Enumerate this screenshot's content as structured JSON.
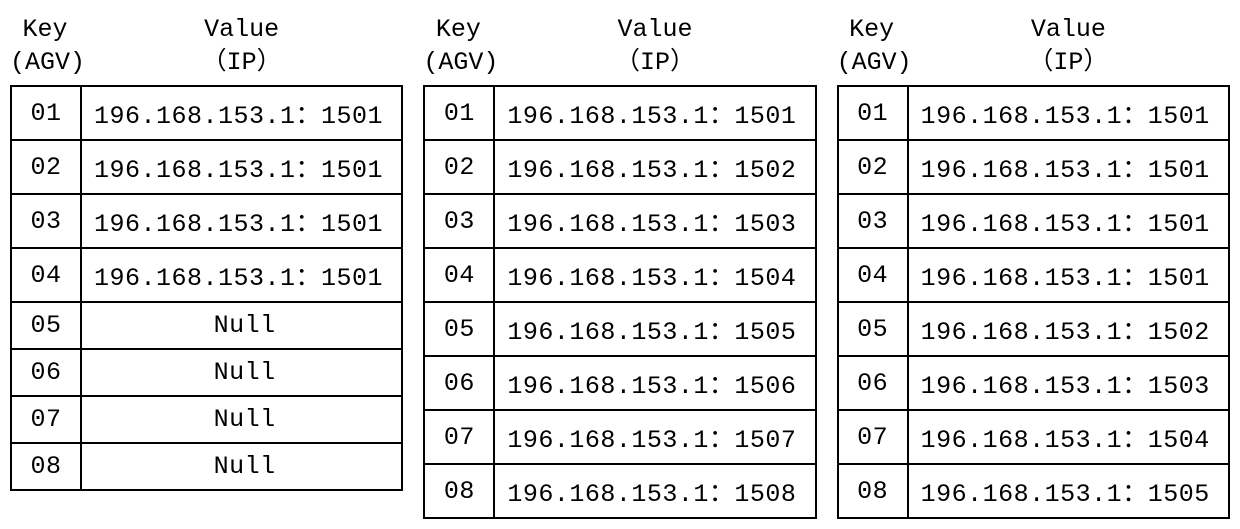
{
  "headers": {
    "key_line1": "Key",
    "key_line2": "(AGV)",
    "value_line1": "Value",
    "value_line2": "（IP）"
  },
  "tables": [
    {
      "rows": [
        {
          "key": "01",
          "value": "196.168.153.1：1501",
          "is_null": false
        },
        {
          "key": "02",
          "value": "196.168.153.1：1501",
          "is_null": false
        },
        {
          "key": "03",
          "value": "196.168.153.1：1501",
          "is_null": false
        },
        {
          "key": "04",
          "value": "196.168.153.1：1501",
          "is_null": false
        },
        {
          "key": "05",
          "value": "Null",
          "is_null": true
        },
        {
          "key": "06",
          "value": "Null",
          "is_null": true
        },
        {
          "key": "07",
          "value": "Null",
          "is_null": true
        },
        {
          "key": "08",
          "value": "Null",
          "is_null": true
        }
      ]
    },
    {
      "rows": [
        {
          "key": "01",
          "value": "196.168.153.1：1501",
          "is_null": false
        },
        {
          "key": "02",
          "value": "196.168.153.1：1502",
          "is_null": false
        },
        {
          "key": "03",
          "value": "196.168.153.1：1503",
          "is_null": false
        },
        {
          "key": "04",
          "value": "196.168.153.1：1504",
          "is_null": false
        },
        {
          "key": "05",
          "value": "196.168.153.1：1505",
          "is_null": false
        },
        {
          "key": "06",
          "value": "196.168.153.1：1506",
          "is_null": false
        },
        {
          "key": "07",
          "value": "196.168.153.1：1507",
          "is_null": false
        },
        {
          "key": "08",
          "value": "196.168.153.1：1508",
          "is_null": false
        }
      ]
    },
    {
      "rows": [
        {
          "key": "01",
          "value": "196.168.153.1：1501",
          "is_null": false
        },
        {
          "key": "02",
          "value": "196.168.153.1：1501",
          "is_null": false
        },
        {
          "key": "03",
          "value": "196.168.153.1：1501",
          "is_null": false
        },
        {
          "key": "04",
          "value": "196.168.153.1：1501",
          "is_null": false
        },
        {
          "key": "05",
          "value": "196.168.153.1：1502",
          "is_null": false
        },
        {
          "key": "06",
          "value": "196.168.153.1：1503",
          "is_null": false
        },
        {
          "key": "07",
          "value": "196.168.153.1：1504",
          "is_null": false
        },
        {
          "key": "08",
          "value": "196.168.153.1：1505",
          "is_null": false
        }
      ]
    }
  ]
}
